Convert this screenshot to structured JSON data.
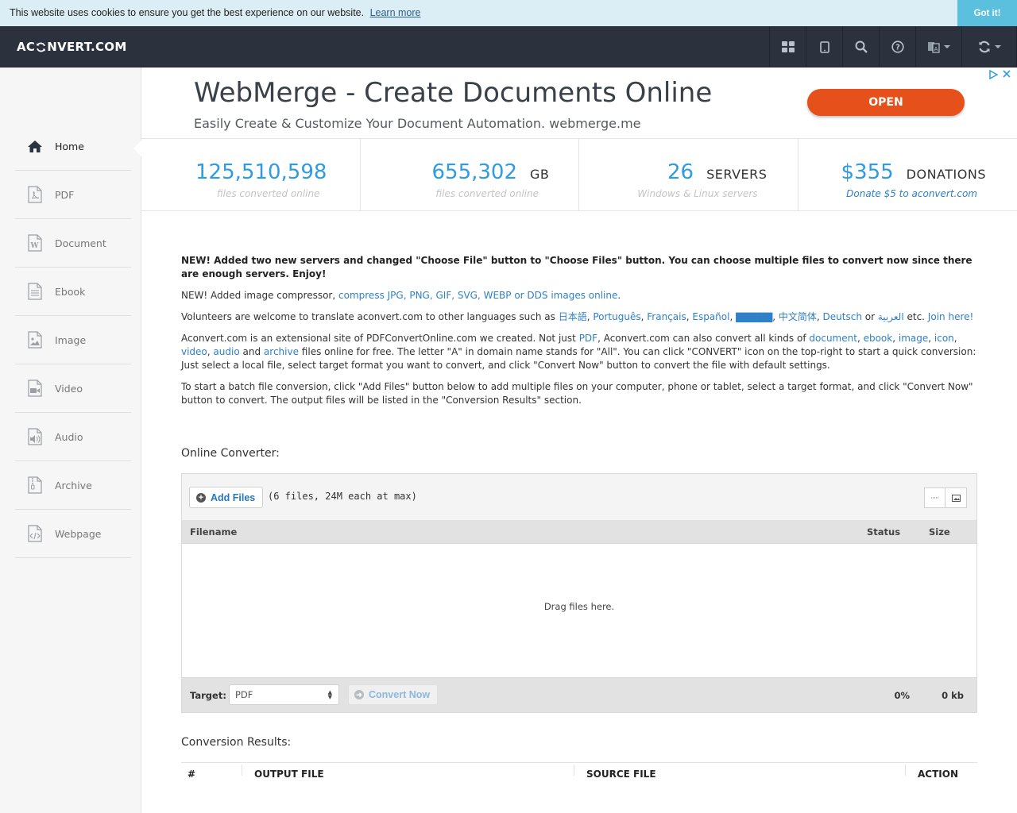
{
  "cookie": {
    "message": "This website uses cookies to ensure you get the best experience on our website.",
    "learn_more": "Learn more",
    "got_it": "Got it!"
  },
  "navbar": {
    "logo_left": "AC",
    "logo_right": "NVERT.COM",
    "icons": [
      "apps-grid-icon",
      "tablet-icon",
      "search-icon",
      "help-icon",
      "language-icon",
      "convert-sync-icon"
    ]
  },
  "sidebar": {
    "items": [
      {
        "label": "Home",
        "icon": "home-icon",
        "active": true
      },
      {
        "label": "PDF",
        "icon": "pdf-file-icon"
      },
      {
        "label": "Document",
        "icon": "document-file-icon"
      },
      {
        "label": "Ebook",
        "icon": "ebook-file-icon"
      },
      {
        "label": "Image",
        "icon": "image-file-icon"
      },
      {
        "label": "Video",
        "icon": "video-file-icon"
      },
      {
        "label": "Audio",
        "icon": "audio-file-icon"
      },
      {
        "label": "Archive",
        "icon": "archive-file-icon"
      },
      {
        "label": "Webpage",
        "icon": "webpage-file-icon"
      }
    ]
  },
  "ad": {
    "title": "WebMerge - Create Documents Online",
    "subtitle": "Easily Create & Customize Your Document Automation.",
    "domain": "webmerge.me",
    "button": "OPEN"
  },
  "stats": [
    {
      "value": "125,510,598",
      "unit": "",
      "desc": "files converted online"
    },
    {
      "value": "655,302",
      "unit": "GB",
      "desc": "files converted online"
    },
    {
      "value": "26",
      "unit": "SERVERS",
      "desc": "Windows & Linux servers"
    },
    {
      "value": "$355",
      "unit": "DONATIONS",
      "desc": "Donate $5 to aconvert.com"
    }
  ],
  "content": {
    "news1": "NEW! Added two new servers and changed \"Choose File\" button to \"Choose Files\" button. You can choose multiple files to convert now since there are enough servers. Enjoy!",
    "news2_prefix": "NEW! Added image compressor,",
    "news2_link": "compress JPG, PNG, GIF, SVG, WEBP or DDS images online",
    "volunteers_prefix": "Volunteers are welcome to translate aconvert.com to other languages such as",
    "languages": [
      "日本語",
      "Português",
      "Français",
      "Español",
      "▇▇▇▇▇",
      "中文简体",
      "Deutsch"
    ],
    "lang_or": "or",
    "lang_arabic": "العربية",
    "lang_etc": "etc.",
    "join": "Join here!",
    "about_1": "Aconvert.com is an extensional site of PDFConvertOnline.com we created. Not just",
    "about_pdf": "PDF",
    "about_2": ", Aconvert.com can also convert all kinds of",
    "about_links": [
      "document",
      "ebook",
      "image",
      "icon",
      "video",
      "audio"
    ],
    "about_and": "and",
    "about_archive": "archive",
    "about_3": "files online for free. The letter \"A\" in domain name stands for \"All\". You can click \"CONVERT\" icon on the top-right to start a quick conversion: Just select a local file, select target format you want to convert, and click \"Convert Now\" button to convert the file with default settings.",
    "batch": "To start a batch file conversion, click \"Add Files\" button below to add multiple files on your computer, phone or tablet, select a target format, and click \"Convert Now\" button to convert. The output files will be listed in the \"Conversion Results\" section."
  },
  "converter": {
    "heading": "Online Converter:",
    "add_files": "Add Files",
    "max_note": "(6 files, 24M each at max)",
    "col_filename": "Filename",
    "col_status": "Status",
    "col_size": "Size",
    "drag_text": "Drag files here.",
    "target_label": "Target:",
    "target_value": "PDF",
    "convert_now": "Convert Now",
    "percent": "0%",
    "total_size": "0 kb"
  },
  "results": {
    "heading": "Conversion Results:",
    "cols": [
      "#",
      "OUTPUT FILE",
      "SOURCE FILE",
      "ACTION"
    ]
  }
}
